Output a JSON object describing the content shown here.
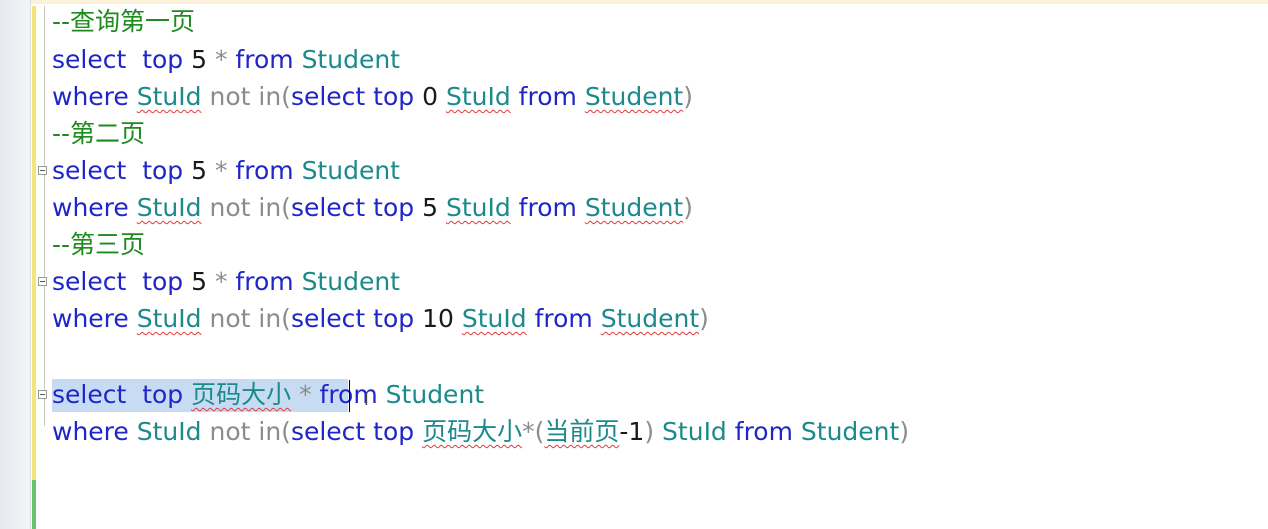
{
  "editor": {
    "lines": [
      {
        "tokens": [
          {
            "text": "--查询第一页",
            "kind": "cmt"
          }
        ]
      },
      {
        "tokens": [
          {
            "text": "select",
            "kind": "kw"
          },
          {
            "text": "  ",
            "kind": "kw"
          },
          {
            "text": "top",
            "kind": "kw"
          },
          {
            "text": " ",
            "kind": "kw"
          },
          {
            "text": "5",
            "kind": "num"
          },
          {
            "text": " ",
            "kind": "kw"
          },
          {
            "text": "*",
            "kind": "op"
          },
          {
            "text": " ",
            "kind": "kw"
          },
          {
            "text": "from",
            "kind": "kw"
          },
          {
            "text": " ",
            "kind": "kw"
          },
          {
            "text": "Student",
            "kind": "obj"
          }
        ]
      },
      {
        "tokens": [
          {
            "text": "where",
            "kind": "kw"
          },
          {
            "text": " ",
            "kind": "kw"
          },
          {
            "text": "StuId",
            "kind": "obj",
            "err": true
          },
          {
            "text": " ",
            "kind": "kw"
          },
          {
            "text": "not",
            "kind": "op"
          },
          {
            "text": " ",
            "kind": "kw"
          },
          {
            "text": "in",
            "kind": "op"
          },
          {
            "text": "(",
            "kind": "op"
          },
          {
            "text": "select",
            "kind": "kw"
          },
          {
            "text": " ",
            "kind": "kw"
          },
          {
            "text": "top",
            "kind": "kw"
          },
          {
            "text": " ",
            "kind": "kw"
          },
          {
            "text": "0",
            "kind": "num"
          },
          {
            "text": " ",
            "kind": "kw"
          },
          {
            "text": "StuId",
            "kind": "obj",
            "err": true
          },
          {
            "text": " ",
            "kind": "kw"
          },
          {
            "text": "from",
            "kind": "kw"
          },
          {
            "text": " ",
            "kind": "kw"
          },
          {
            "text": "Student",
            "kind": "obj",
            "err": true
          },
          {
            "text": ")",
            "kind": "op"
          }
        ]
      },
      {
        "tokens": [
          {
            "text": "--第二页",
            "kind": "cmt"
          }
        ]
      },
      {
        "fold": true,
        "tokens": [
          {
            "text": "select",
            "kind": "kw"
          },
          {
            "text": "  ",
            "kind": "kw"
          },
          {
            "text": "top",
            "kind": "kw"
          },
          {
            "text": " ",
            "kind": "kw"
          },
          {
            "text": "5",
            "kind": "num"
          },
          {
            "text": " ",
            "kind": "kw"
          },
          {
            "text": "*",
            "kind": "op"
          },
          {
            "text": " ",
            "kind": "kw"
          },
          {
            "text": "from",
            "kind": "kw"
          },
          {
            "text": " ",
            "kind": "kw"
          },
          {
            "text": "Student",
            "kind": "obj"
          }
        ]
      },
      {
        "tokens": [
          {
            "text": "where",
            "kind": "kw"
          },
          {
            "text": " ",
            "kind": "kw"
          },
          {
            "text": "StuId",
            "kind": "obj",
            "err": true
          },
          {
            "text": " ",
            "kind": "kw"
          },
          {
            "text": "not",
            "kind": "op"
          },
          {
            "text": " ",
            "kind": "kw"
          },
          {
            "text": "in",
            "kind": "op"
          },
          {
            "text": "(",
            "kind": "op"
          },
          {
            "text": "select",
            "kind": "kw"
          },
          {
            "text": " ",
            "kind": "kw"
          },
          {
            "text": "top",
            "kind": "kw"
          },
          {
            "text": " ",
            "kind": "kw"
          },
          {
            "text": "5",
            "kind": "num"
          },
          {
            "text": " ",
            "kind": "kw"
          },
          {
            "text": "StuId",
            "kind": "obj",
            "err": true
          },
          {
            "text": " ",
            "kind": "kw"
          },
          {
            "text": "from",
            "kind": "kw"
          },
          {
            "text": " ",
            "kind": "kw"
          },
          {
            "text": "Student",
            "kind": "obj",
            "err": true
          },
          {
            "text": ")",
            "kind": "op"
          }
        ]
      },
      {
        "tokens": [
          {
            "text": "--第三页",
            "kind": "cmt"
          }
        ]
      },
      {
        "fold": true,
        "tokens": [
          {
            "text": "select",
            "kind": "kw"
          },
          {
            "text": "  ",
            "kind": "kw"
          },
          {
            "text": "top",
            "kind": "kw"
          },
          {
            "text": " ",
            "kind": "kw"
          },
          {
            "text": "5",
            "kind": "num"
          },
          {
            "text": " ",
            "kind": "kw"
          },
          {
            "text": "*",
            "kind": "op"
          },
          {
            "text": " ",
            "kind": "kw"
          },
          {
            "text": "from",
            "kind": "kw"
          },
          {
            "text": " ",
            "kind": "kw"
          },
          {
            "text": "Student",
            "kind": "obj"
          }
        ]
      },
      {
        "tokens": [
          {
            "text": "where",
            "kind": "kw"
          },
          {
            "text": " ",
            "kind": "kw"
          },
          {
            "text": "StuId",
            "kind": "obj",
            "err": true
          },
          {
            "text": " ",
            "kind": "kw"
          },
          {
            "text": "not",
            "kind": "op"
          },
          {
            "text": " ",
            "kind": "kw"
          },
          {
            "text": "in",
            "kind": "op"
          },
          {
            "text": "(",
            "kind": "op"
          },
          {
            "text": "select",
            "kind": "kw"
          },
          {
            "text": " ",
            "kind": "kw"
          },
          {
            "text": "top",
            "kind": "kw"
          },
          {
            "text": " ",
            "kind": "kw"
          },
          {
            "text": "10",
            "kind": "num"
          },
          {
            "text": " ",
            "kind": "kw"
          },
          {
            "text": "StuId",
            "kind": "obj",
            "err": true
          },
          {
            "text": " ",
            "kind": "kw"
          },
          {
            "text": "from",
            "kind": "kw"
          },
          {
            "text": " ",
            "kind": "kw"
          },
          {
            "text": "Student",
            "kind": "obj",
            "err": true
          },
          {
            "text": ")",
            "kind": "op"
          }
        ]
      },
      {
        "tokens": []
      },
      {
        "fold": true,
        "tokens": [
          {
            "text": "select",
            "kind": "kw"
          },
          {
            "text": "  ",
            "kind": "kw"
          },
          {
            "text": "top",
            "kind": "kw"
          },
          {
            "text": " ",
            "kind": "kw"
          },
          {
            "text": "页码大小",
            "kind": "obj",
            "err": true
          },
          {
            "text": " ",
            "kind": "kw"
          },
          {
            "text": "*",
            "kind": "op"
          },
          {
            "text": " ",
            "kind": "kw"
          },
          {
            "text": "from",
            "kind": "kw"
          },
          {
            "text": " ",
            "kind": "kw"
          },
          {
            "text": "Student",
            "kind": "obj"
          }
        ]
      },
      {
        "tokens": [
          {
            "text": "where",
            "kind": "kw"
          },
          {
            "text": " ",
            "kind": "kw"
          },
          {
            "text": "StuId",
            "kind": "obj"
          },
          {
            "text": " ",
            "kind": "kw"
          },
          {
            "text": "not",
            "kind": "op"
          },
          {
            "text": " ",
            "kind": "kw"
          },
          {
            "text": "in",
            "kind": "op"
          },
          {
            "text": "(",
            "kind": "op"
          },
          {
            "text": "select",
            "kind": "kw"
          },
          {
            "text": " ",
            "kind": "kw"
          },
          {
            "text": "top",
            "kind": "kw"
          },
          {
            "text": " ",
            "kind": "kw"
          },
          {
            "text": "页码大小",
            "kind": "obj",
            "err": true
          },
          {
            "text": "*(",
            "kind": "op"
          },
          {
            "text": "当前页",
            "kind": "obj",
            "err": true
          },
          {
            "text": "-1",
            "kind": "num"
          },
          {
            "text": ")",
            "kind": "op"
          },
          {
            "text": " ",
            "kind": "kw"
          },
          {
            "text": "StuId",
            "kind": "obj"
          },
          {
            "text": " ",
            "kind": "kw"
          },
          {
            "text": "from",
            "kind": "kw"
          },
          {
            "text": " ",
            "kind": "kw"
          },
          {
            "text": "Student",
            "kind": "obj"
          },
          {
            "text": ")",
            "kind": "op"
          }
        ]
      }
    ]
  }
}
